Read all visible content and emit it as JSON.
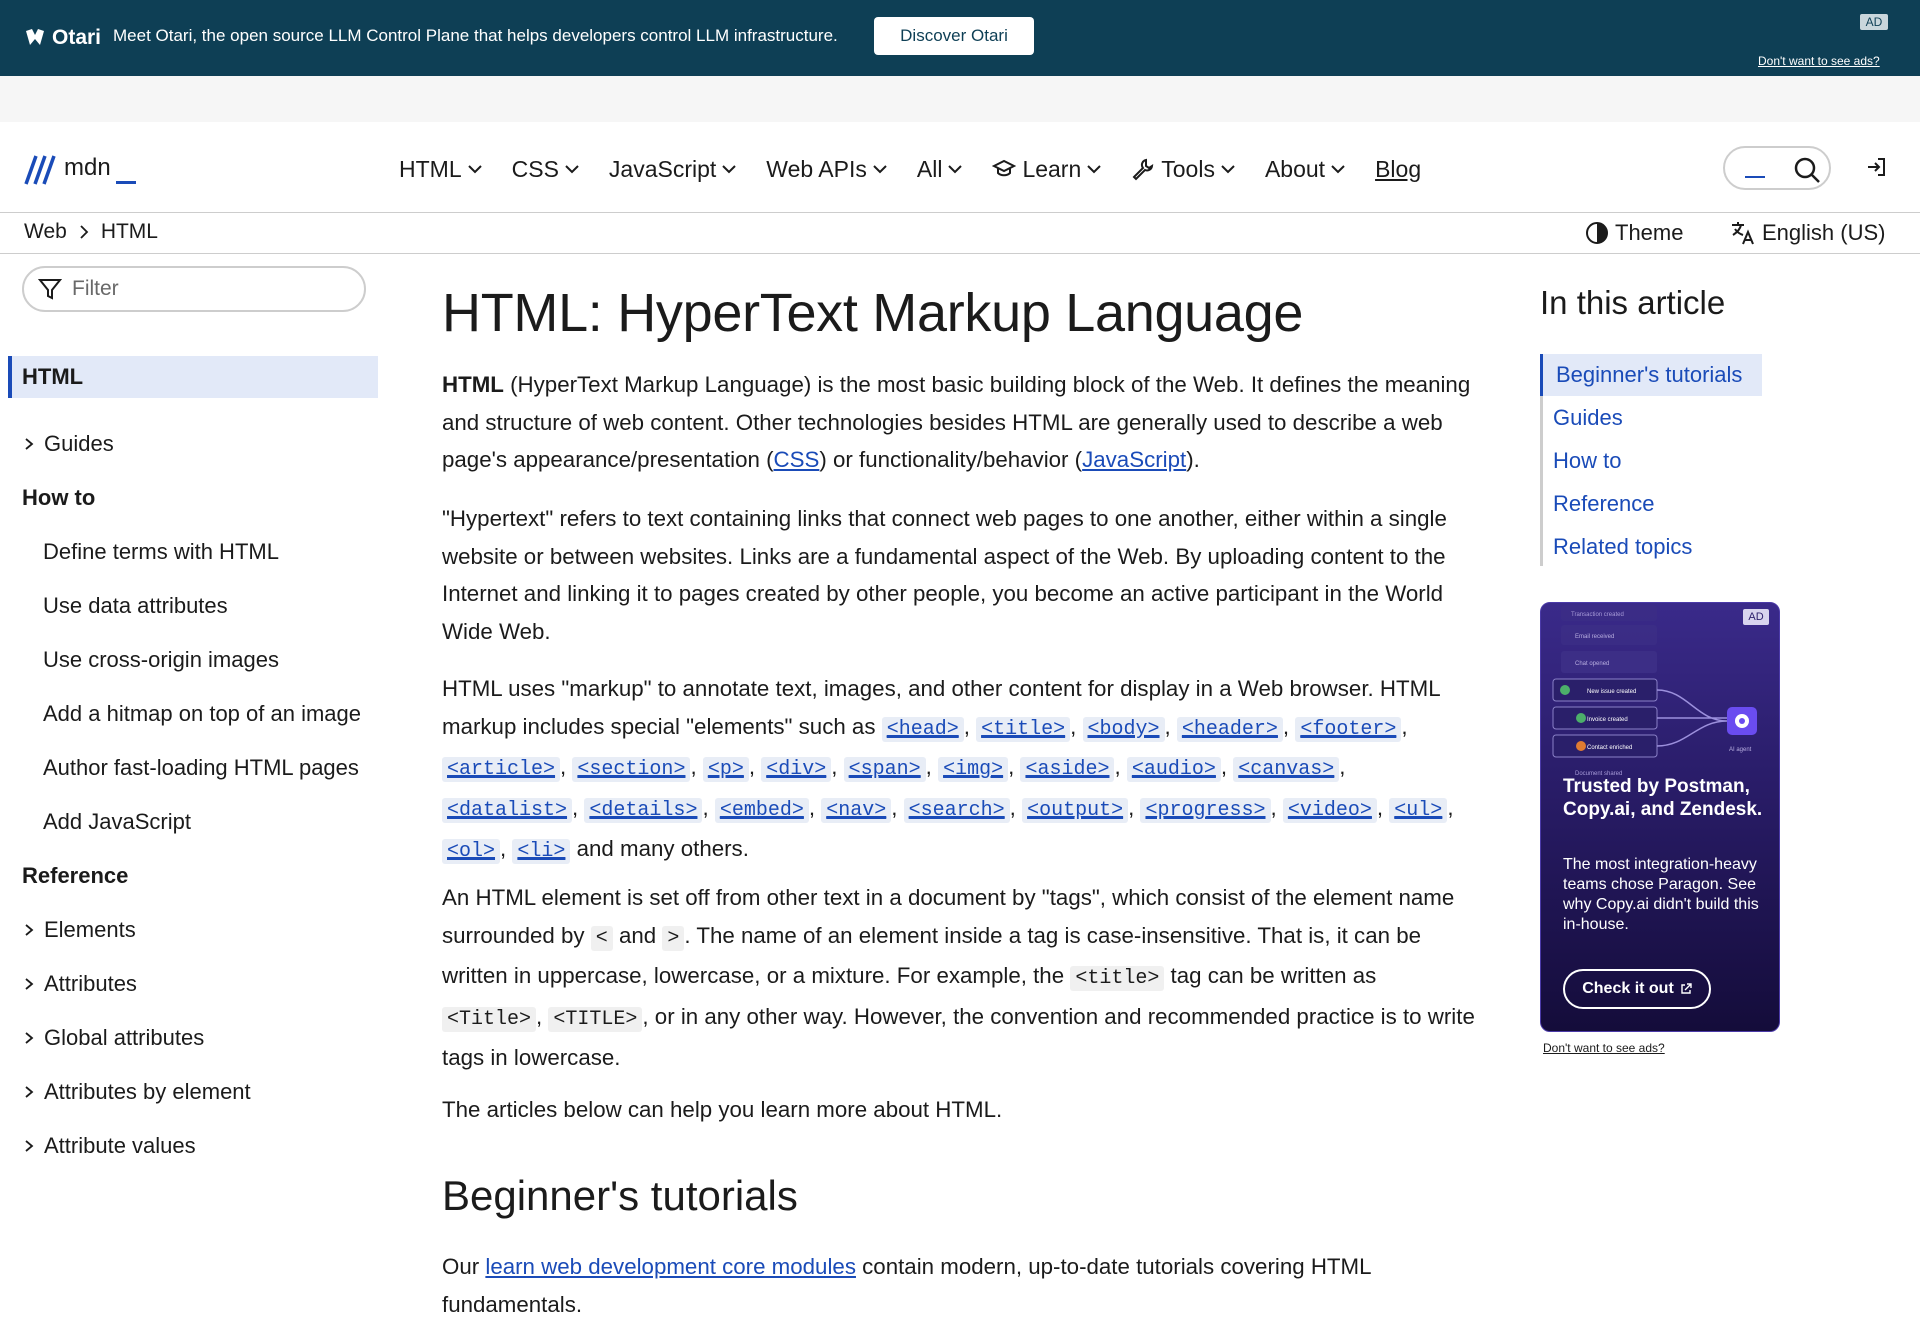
{
  "ad_banner": {
    "brand": "Otari",
    "message": "Meet Otari, the open source LLM Control Plane that helps developers control LLM infrastructure.",
    "cta": "Discover Otari",
    "badge": "AD",
    "no_ads": "Don't want to see ads?"
  },
  "header": {
    "logo_text": "mdn",
    "menu": [
      {
        "label": "HTML"
      },
      {
        "label": "CSS"
      },
      {
        "label": "JavaScript"
      },
      {
        "label": "Web APIs"
      },
      {
        "label": "All"
      },
      {
        "label": "Learn",
        "icon": "graduation-cap-icon"
      },
      {
        "label": "Tools",
        "icon": "wrench-icon"
      },
      {
        "label": "About"
      },
      {
        "label": "Blog"
      }
    ]
  },
  "breadcrumb": [
    "Web",
    "HTML"
  ],
  "theme_label": "Theme",
  "language_label": "English (US)",
  "sidebar": {
    "filter_placeholder": "Filter",
    "current": "HTML",
    "guides": "Guides",
    "how_to_heading": "How to",
    "how_to_items": [
      "Define terms with HTML",
      "Use data attributes",
      "Use cross-origin images",
      "Add a hitmap on top of an image",
      "Author fast-loading HTML pages",
      "Add JavaScript"
    ],
    "reference_heading": "Reference",
    "reference_items": [
      "Elements",
      "Attributes",
      "Global attributes",
      "Attributes by element",
      "Attribute values"
    ]
  },
  "article": {
    "title": "HTML: HyperText Markup Language",
    "p1": {
      "bold": "HTML",
      "text1": " (HyperText Markup Language) is the most basic building block of the Web. It defines the meaning and structure of web content. Other technologies besides HTML are generally used to describe a web page's appearance/presentation (",
      "link_css": "CSS",
      "text2": ") or functionality/behavior (",
      "link_js": "JavaScript",
      "text3": ")."
    },
    "p2": "\"Hypertext\" refers to text containing links that connect web pages to one another, either within a single website or between websites. Links are a fundamental aspect of the Web. By uploading content to the Internet and linking it to pages created by other people, you become an active participant in the World Wide Web.",
    "p3": {
      "text1": "HTML uses \"markup\" to annotate text, images, and other content for display in a Web browser. HTML markup includes special \"elements\" such as",
      "elements": [
        "<head>",
        "<title>",
        "<body>",
        "<header>",
        "<footer>",
        "<article>",
        "<section>",
        "<p>",
        "<div>",
        "<span>",
        "<img>",
        "<aside>",
        "<audio>",
        "<canvas>",
        "<datalist>",
        "<details>",
        "<embed>",
        "<nav>",
        "<search>",
        "<output>",
        "<progress>",
        "<video>",
        "<ul>",
        "<ol>",
        "<li>"
      ],
      "text2": "and many others."
    },
    "p4": {
      "text1": "An HTML element is set off from other text in a document by \"tags\", which consist of the element name surrounded by",
      "lt": "<",
      "and": "and",
      "gt": ">",
      "text2": ". The name of an element inside a tag is case-insensitive. That is, it can be written in uppercase, lowercase, or a mixture. For example, the",
      "tag_lower": "<title>",
      "text3": "tag can be written as",
      "tag_mixed": "<Title>",
      "tag_upper": "<TITLE>",
      "text4": ", or in any other way. However, the convention and recommended practice is to write tags in lowercase."
    },
    "p5": "The articles below can help you learn more about HTML.",
    "h2": "Beginner's tutorials",
    "p6": {
      "text1": "Our ",
      "link": "learn web development core modules",
      "text2": " contain modern, up-to-date tutorials covering HTML fundamentals."
    }
  },
  "toc": {
    "title": "In this article",
    "items": [
      "Beginner's tutorials",
      "Guides",
      "How to",
      "Reference",
      "Related topics"
    ]
  },
  "side_ad": {
    "badge": "AD",
    "flow_labels": [
      "Transaction created",
      "Email received",
      "Chat opened",
      "New issue created",
      "Invoice created",
      "Contact enriched",
      "Document shared",
      "AI agent"
    ],
    "headline": "Trusted by Postman, Copy.ai, and Zendesk.",
    "body": "The most integration-heavy teams chose Paragon. See why Copy.ai didn't build this in-house.",
    "cta": "Check it out",
    "no_ads": "Don't want to see ads?"
  },
  "colors": {
    "ad_bar": "#0e3f55",
    "link": "#1a4bb8",
    "current_bg": "#e2e9f8",
    "side_ad_bg": "#2a1d6a"
  }
}
